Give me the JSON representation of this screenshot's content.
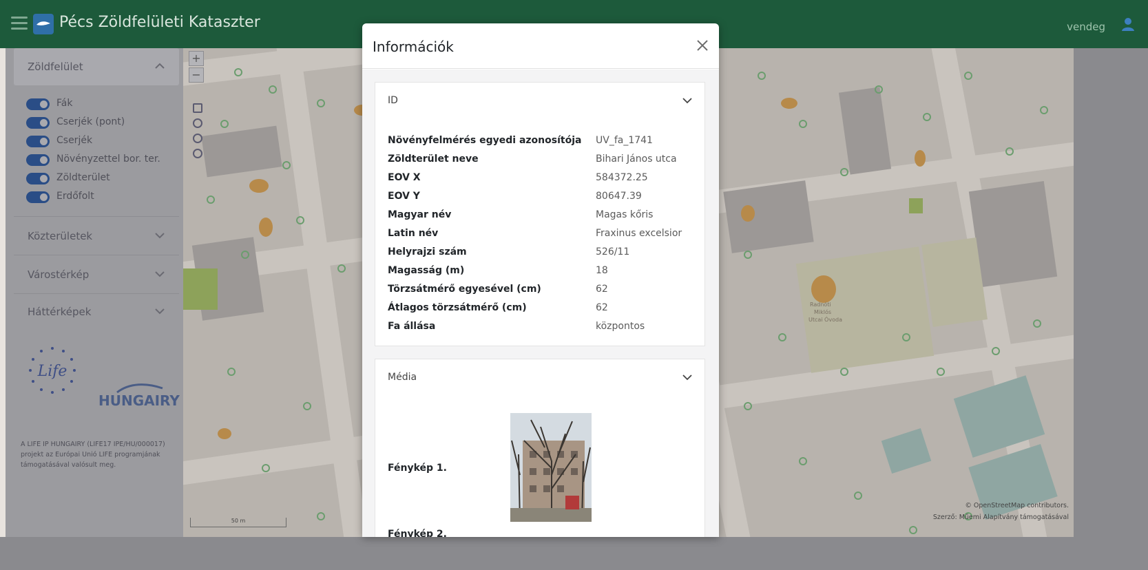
{
  "app": {
    "title": "Pécs Zöldfelületi Kataszter",
    "user": "vendeg"
  },
  "sidebar": {
    "sections": [
      {
        "label": "Zöldfelület"
      },
      {
        "label": "Közterületek"
      },
      {
        "label": "Várostérkép"
      },
      {
        "label": "Háttérképek"
      }
    ],
    "layers": [
      {
        "label": "Fák",
        "enabled": true
      },
      {
        "label": "Cserjék (pont)",
        "enabled": true
      },
      {
        "label": "Cserjék",
        "enabled": true
      },
      {
        "label": "Növényzettel bor. ter.",
        "enabled": true
      },
      {
        "label": "Zöldterület",
        "enabled": true
      },
      {
        "label": "Erdőfolt",
        "enabled": true
      }
    ],
    "partner_logo_text": "HUNGAIRY",
    "life_logo_text": "Life",
    "note": "A LIFE IP HUNGAIRY (LIFE17 IPE/HU/000017) projekt az Európai Unió LIFE programjának támogatásával valósult meg."
  },
  "map": {
    "zoom_in": "+",
    "zoom_out": "−",
    "attribution_1": "© OpenStreetMap contributors.",
    "attribution_2": "Szerző: Műemi Alapítvány támogatásával",
    "scale": "50 m"
  },
  "modal": {
    "title": "Információk",
    "close_icon": "close-icon",
    "id_section": {
      "label": "ID",
      "rows": [
        {
          "key": "Növényfelmérés egyedi azonosítója",
          "value": "UV_fa_1741"
        },
        {
          "key": "Zöldterület neve",
          "value": "Bihari János utca"
        },
        {
          "key": "EOV X",
          "value": "584372.25"
        },
        {
          "key": "EOV Y",
          "value": "80647.39"
        },
        {
          "key": "Magyar név",
          "value": "Magas kőris"
        },
        {
          "key": "Latin név",
          "value": "Fraxinus excelsior"
        },
        {
          "key": "Helyrajzi szám",
          "value": "526/11"
        },
        {
          "key": "Magasság (m)",
          "value": "18"
        },
        {
          "key": "Törzsátmérő egyesével (cm)",
          "value": "62"
        },
        {
          "key": "Átlagos törzsátmérő (cm)",
          "value": "62"
        },
        {
          "key": "Fa állása",
          "value": "központos"
        }
      ]
    },
    "media_section": {
      "label": "Média",
      "photo1_label": "Fénykép 1.",
      "photo2_label": "Fénykép 2."
    }
  },
  "colors": {
    "header": "#1d5a3b",
    "toggle_on": "#2a4d86"
  }
}
